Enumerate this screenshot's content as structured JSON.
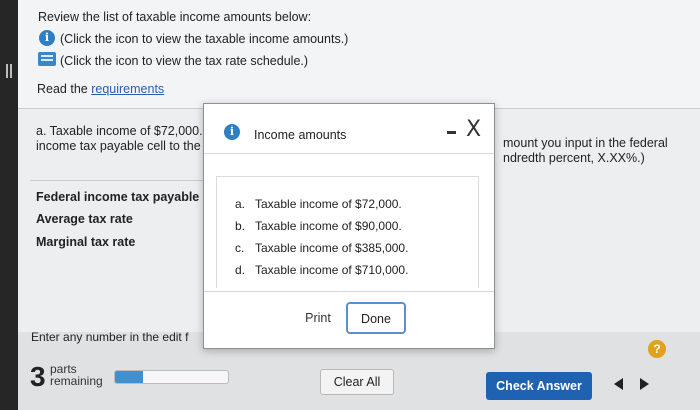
{
  "instructions": {
    "review_text": "Review the list of taxable income amounts below:",
    "income_link_text": "(Click the icon to view the taxable income amounts.)",
    "schedule_link_text": "(Click the icon to view the tax rate schedule.)",
    "read_prefix": "Read the ",
    "requirements_link": "requirements"
  },
  "question": {
    "part_a_line1": "a. Taxable income of $72,000.",
    "part_a_line2": "income tax payable cell to the",
    "hint_line1": "mount you input in the federal",
    "hint_line2": "ndredth percent, X.XX%.)"
  },
  "answer_rows": [
    "Federal income tax payable",
    "Average tax rate",
    "Marginal tax rate"
  ],
  "enter_text": "Enter any number in the edit f",
  "footer": {
    "parts_number": "3",
    "parts_label_1": "parts",
    "parts_label_2": "remaining",
    "progress_fraction": 0.25,
    "clear_all": "Clear All",
    "check_answer": "Check Answer",
    "help": "?"
  },
  "modal": {
    "title": "Income amounts",
    "close": "X",
    "items": [
      {
        "letter": "a.",
        "text": "Taxable income of $72,000."
      },
      {
        "letter": "b.",
        "text": "Taxable income of $90,000."
      },
      {
        "letter": "c.",
        "text": "Taxable income of $385,000."
      },
      {
        "letter": "d.",
        "text": "Taxable income of $710,000."
      }
    ],
    "print": "Print",
    "done": "Done"
  },
  "icons": {
    "info": "i",
    "info_color": "#2f7fc4",
    "check_color": "#1f62b2",
    "help_color": "#e0a21b"
  }
}
